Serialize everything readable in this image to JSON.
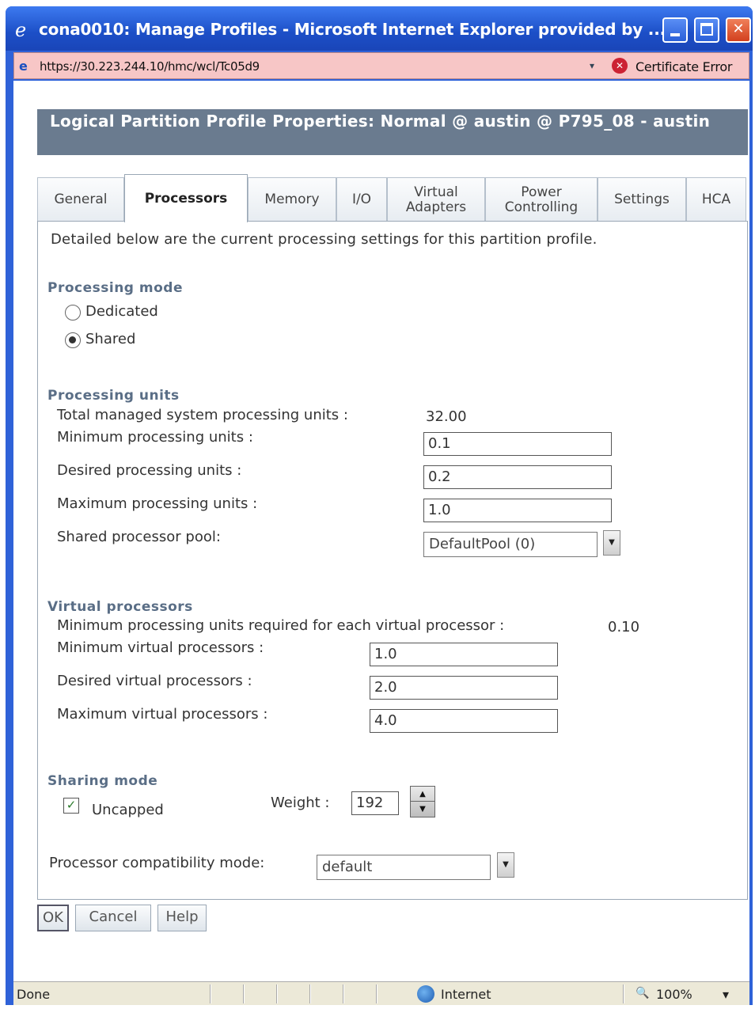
{
  "window": {
    "ie_icon": "ie-logo-icon",
    "title": "cona0010: Manage Profiles - Microsoft Internet Explorer provided by ...",
    "controls": {
      "minimize": "minimize-icon",
      "maximize": "maximize-icon",
      "close": "✕"
    }
  },
  "address": {
    "url": "https://30.223.244.10/hmc/wcl/Tc05d9",
    "page_icon": "e",
    "dropdown": "▾",
    "cert_icon": "✕",
    "cert_error": "Certificate Error"
  },
  "header": {
    "title": "Logical Partition Profile Properties: Normal @ austin @ P795_08 - austin"
  },
  "tabs": [
    {
      "label": "General",
      "active": false
    },
    {
      "label": "Processors",
      "active": true
    },
    {
      "label": "Memory",
      "active": false
    },
    {
      "label": "I/O",
      "active": false
    },
    {
      "label": "Virtual Adapters",
      "active": false
    },
    {
      "label": "Power Controlling",
      "active": false
    },
    {
      "label": "Settings",
      "active": false
    },
    {
      "label": "HCA",
      "active": false
    }
  ],
  "description": "Detailed below are the current processing settings for this partition profile.",
  "processing_mode": {
    "heading": "Processing mode",
    "options": [
      {
        "label": "Dedicated",
        "selected": false
      },
      {
        "label": "Shared",
        "selected": true
      }
    ]
  },
  "processing_units": {
    "heading": "Processing units",
    "total_label": "Total managed system processing units :",
    "total_value": "32.00",
    "min_label": "Minimum processing units :",
    "min_value": "0.1",
    "desired_label": "Desired processing units :",
    "desired_value": "0.2",
    "max_label": "Maximum processing units :",
    "max_value": "1.0",
    "pool_label": "Shared processor pool:",
    "pool_value": "DefaultPool (0)"
  },
  "virtual_processors": {
    "heading": "Virtual processors",
    "min_required_label": "Minimum processing units required for each virtual processor :",
    "min_required_value": "0.10",
    "min_label": "Minimum virtual processors :",
    "min_value": "1.0",
    "desired_label": "Desired virtual processors :",
    "desired_value": "2.0",
    "max_label": "Maximum virtual processors :",
    "max_value": "4.0"
  },
  "sharing_mode": {
    "heading": "Sharing mode",
    "uncapped_label": "Uncapped",
    "uncapped_checked": true,
    "check_glyph": "✓",
    "weight_label": "Weight :",
    "weight_value": "192",
    "spin_up": "▲",
    "spin_down": "▼"
  },
  "compatibility": {
    "label": "Processor compatibility mode:",
    "value": "default",
    "dropdown": "▼"
  },
  "buttons": {
    "ok": "OK",
    "cancel": "Cancel",
    "help": "Help"
  },
  "status": {
    "text": "Done",
    "zone": "Internet",
    "zoom": "100%",
    "zoom_icon": "🔍",
    "zoom_drop": "▾"
  }
}
